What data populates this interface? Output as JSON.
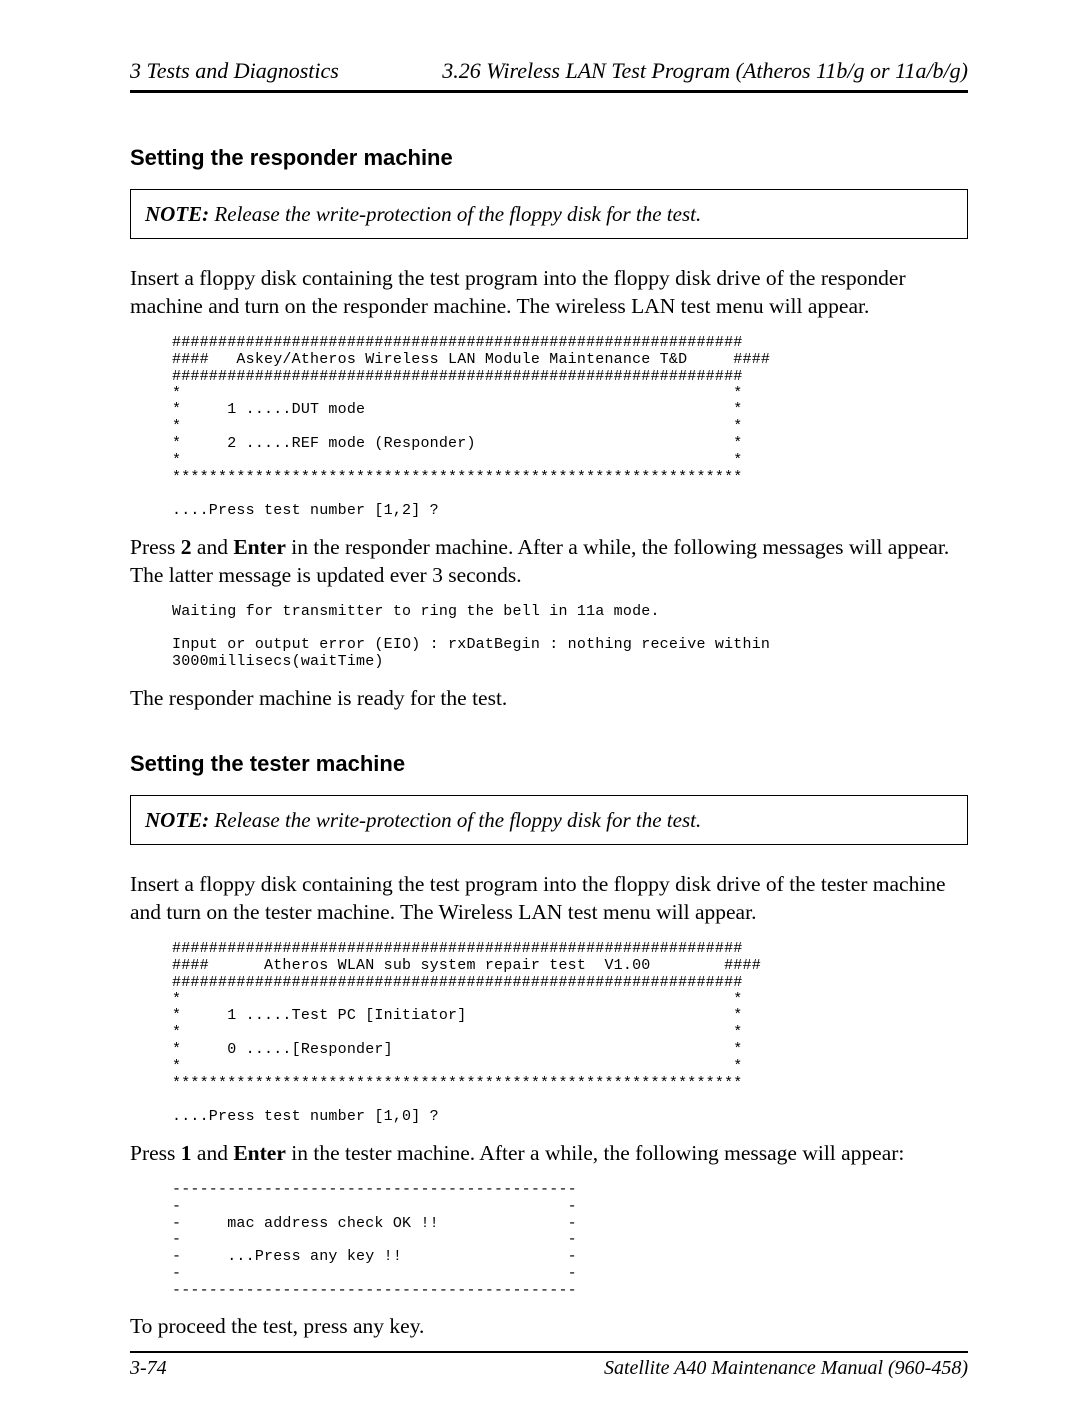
{
  "header": {
    "left": "3  Tests and Diagnostics",
    "right": "3.26  Wireless LAN Test Program (Atheros 11b/g or 11a/b/g)"
  },
  "section1": {
    "heading": "Setting the responder machine",
    "note_label": "NOTE:",
    "note_text": "  Release the write-protection of the floppy disk for the test.",
    "intro": "Insert a floppy disk containing the test program into the floppy disk drive of the responder machine and turn on the responder machine. The wireless LAN test menu will appear.",
    "code": "##############################################################\n####   Askey/Atheros Wireless LAN Module Maintenance T&D     ####\n##############################################################\n*                                                            *\n*     1 .....DUT mode                                        *\n*                                                            *\n*     2 .....REF mode (Responder)                            *\n*                                                            *\n**************************************************************\n\n....Press test number [1,2] ?",
    "press_part_a": "Press ",
    "press_key": "2",
    "press_mid": " and ",
    "enter_key": "Enter",
    "press_part_b": " in the responder machine. After a while, the following messages will appear. The latter message is updated ever 3 seconds.",
    "code2": "Waiting for transmitter to ring the bell in 11a mode.\n\nInput or output error (EIO) : rxDatBegin : nothing receive within\n3000millisecs(waitTime)",
    "ready": "The responder machine is ready for the test."
  },
  "section2": {
    "heading": "Setting the tester machine",
    "note_label": "NOTE:",
    "note_text": "  Release the write-protection of the floppy disk for the test.",
    "intro": "Insert a floppy disk containing the test program into the floppy disk drive of the tester machine and turn on the tester machine. The Wireless LAN test menu will appear.",
    "code": "##############################################################\n####      Atheros WLAN sub system repair test  V1.00        ####\n##############################################################\n*                                                            *\n*     1 .....Test PC [Initiator]                             *\n*                                                            *\n*     0 .....[Responder]                                     *\n*                                                            *\n**************************************************************\n\n....Press test number [1,0] ?",
    "press_part_a": "Press ",
    "press_key": "1",
    "press_mid": " and ",
    "enter_key": "Enter",
    "press_part_b": " in the tester machine. After a while, the following message will appear:",
    "code2": "--------------------------------------------\n-                                          -\n-     mac address check OK !!              -\n-                                          -\n-     ...Press any key !!                  -\n-                                          -\n--------------------------------------------",
    "proceed": "To proceed the test, press any key."
  },
  "footer": {
    "left": "3-74",
    "right": "Satellite A40 Maintenance Manual (960-458)"
  }
}
